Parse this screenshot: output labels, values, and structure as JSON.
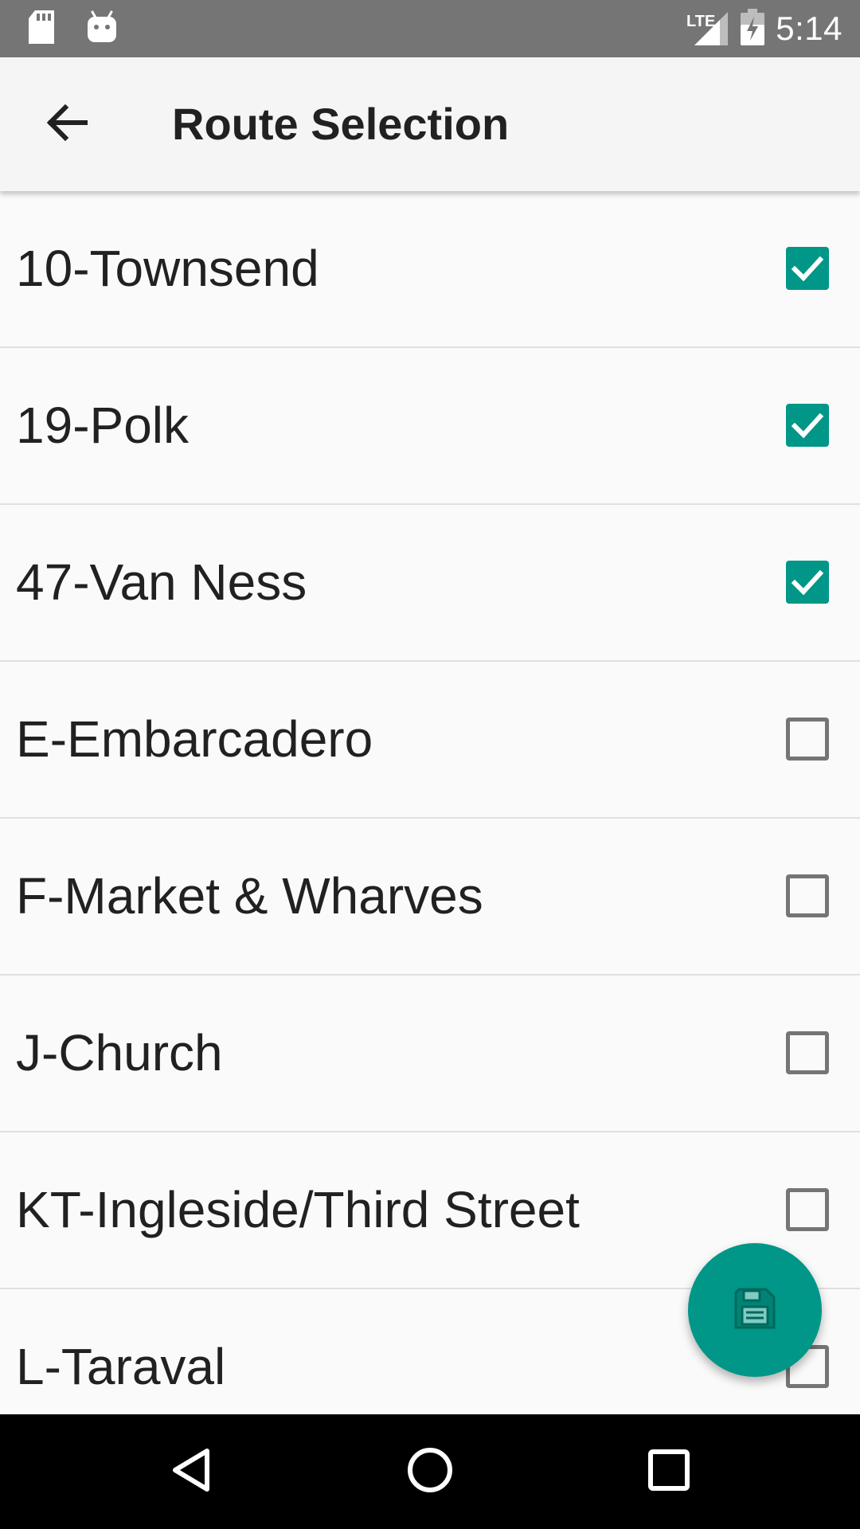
{
  "status_bar": {
    "time": "5:14",
    "network": "LTE",
    "left_icons": [
      "sd-card-icon",
      "android-icon"
    ],
    "right_icons": [
      "signal-icon",
      "battery-charging-icon"
    ]
  },
  "app_bar": {
    "title": "Route Selection",
    "back_icon": "arrow-back-icon"
  },
  "routes": [
    {
      "label": "10-Townsend",
      "checked": true
    },
    {
      "label": "19-Polk",
      "checked": true
    },
    {
      "label": "47-Van Ness",
      "checked": true
    },
    {
      "label": "E-Embarcadero",
      "checked": false
    },
    {
      "label": "F-Market & Wharves",
      "checked": false
    },
    {
      "label": "J-Church",
      "checked": false
    },
    {
      "label": "KT-Ingleside/Third Street",
      "checked": false
    },
    {
      "label": "L-Taraval",
      "checked": false
    }
  ],
  "fab": {
    "icon": "save-icon"
  },
  "nav_bar": {
    "buttons": [
      "back-triangle-icon",
      "home-circle-icon",
      "recents-square-icon"
    ]
  },
  "colors": {
    "accent": "#009688",
    "status_bar": "#757575",
    "app_bar": "#f5f5f5",
    "background": "#fafafa",
    "nav_bar": "#000000"
  }
}
